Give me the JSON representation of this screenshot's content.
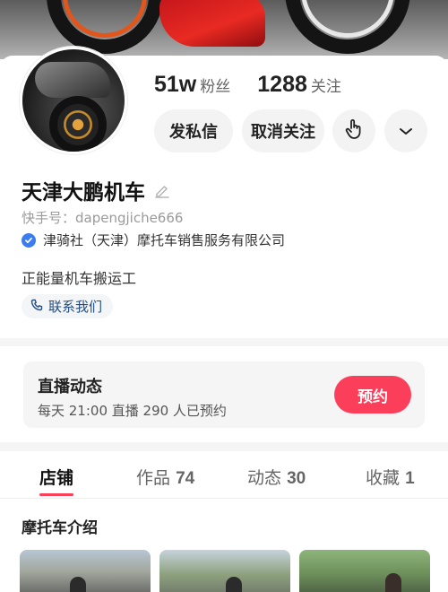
{
  "profile": {
    "followers_count": "51w",
    "followers_label": "粉丝",
    "following_count": "1288",
    "following_label": "关注",
    "name": "天津大鹏机车",
    "kuaishou_id": "快手号：dapengjiche666",
    "certification": "津骑社（天津）摩托车销售服务有限公司",
    "bio": "正能量机车搬运工",
    "contact_label": "联系我们"
  },
  "actions": {
    "message_label": "发私信",
    "unfollow_label": "取消关注",
    "touch_icon": "hand-pointer-icon",
    "more_icon": "chevron-down-icon"
  },
  "live": {
    "title": "直播动态",
    "schedule": "每天 21:00 直播 290 人已预约",
    "book_label": "预约"
  },
  "tabs": [
    {
      "label": "店铺",
      "count": ""
    },
    {
      "label": "作品",
      "count": "74"
    },
    {
      "label": "动态",
      "count": "30"
    },
    {
      "label": "收藏",
      "count": "1"
    }
  ],
  "active_tab": "店铺",
  "section": {
    "title": "摩托车介绍"
  },
  "colors": {
    "accent": "#fb3f5a",
    "verified_blue": "#3c7cf0",
    "link_blue": "#1f4e8a"
  }
}
